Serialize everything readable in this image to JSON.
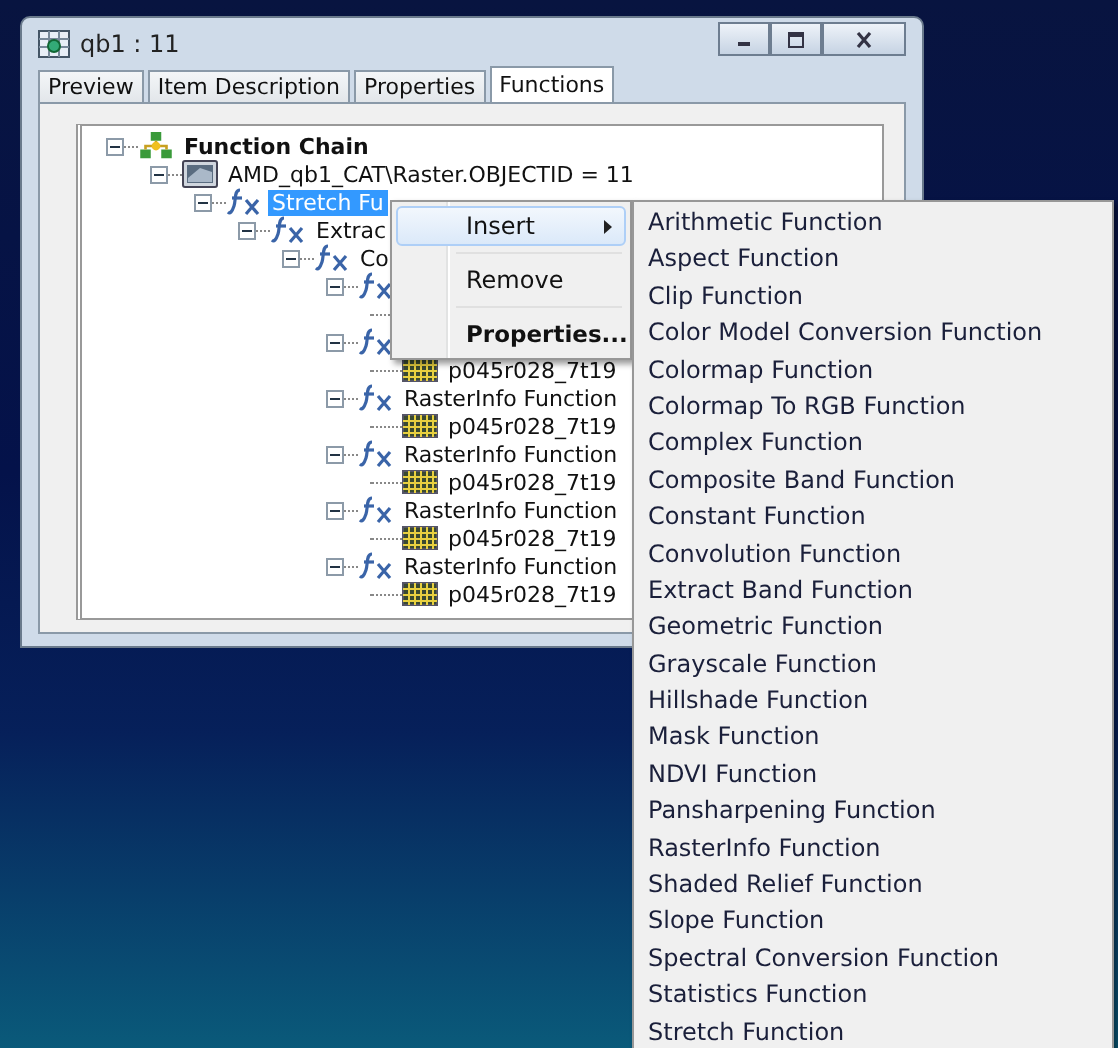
{
  "window": {
    "title": "qb1 : 11"
  },
  "tabs": [
    {
      "label": "Preview",
      "selected": false
    },
    {
      "label": "Item Description",
      "selected": false
    },
    {
      "label": "Properties",
      "selected": false
    },
    {
      "label": "Functions",
      "selected": true
    }
  ],
  "tree": [
    {
      "kind": "chain",
      "label": "Function Chain",
      "expanded": true,
      "selected": false,
      "children": [
        {
          "kind": "dataset",
          "label": "AMD_qb1_CAT\\Raster.OBJECTID = 11",
          "expanded": true,
          "selected": false,
          "children": [
            {
              "kind": "function",
              "label": "Stretch Fu",
              "expanded": true,
              "selected": true,
              "children": [
                {
                  "kind": "function",
                  "label": "Extrac",
                  "expanded": true,
                  "selected": false,
                  "children": [
                    {
                      "kind": "function",
                      "label": "Co",
                      "expanded": true,
                      "selected": false,
                      "children": [
                        {
                          "kind": "function",
                          "expanded": true
                        },
                        {
                          "kind": "function",
                          "expanded": true,
                          "children": [
                            {
                              "kind": "raster",
                              "label": "p045r028_7t19",
                              "selected": false
                            }
                          ]
                        },
                        {
                          "kind": "function",
                          "label": "RasterInfo Function",
                          "expanded": true,
                          "selected": false,
                          "children": [
                            {
                              "kind": "raster",
                              "label": "p045r028_7t19",
                              "selected": false
                            }
                          ]
                        },
                        {
                          "kind": "function",
                          "label": "RasterInfo Function",
                          "expanded": true,
                          "selected": false,
                          "children": [
                            {
                              "kind": "raster",
                              "label": "p045r028_7t19",
                              "selected": false
                            }
                          ]
                        },
                        {
                          "kind": "function",
                          "label": "RasterInfo Function",
                          "expanded": true,
                          "selected": false,
                          "children": [
                            {
                              "kind": "raster",
                              "label": "p045r028_7t19",
                              "selected": false
                            }
                          ]
                        },
                        {
                          "kind": "function",
                          "label": "RasterInfo Function",
                          "expanded": true,
                          "selected": false,
                          "children": [
                            {
                              "kind": "raster",
                              "label": "p045r028_7t19",
                              "selected": false
                            }
                          ]
                        }
                      ]
                    }
                  ]
                }
              ]
            }
          ]
        }
      ]
    }
  ],
  "context_menu": {
    "items": [
      {
        "kind": "submenu",
        "label": "Insert",
        "selected": true
      },
      {
        "kind": "separator"
      },
      {
        "kind": "item",
        "label": "Remove",
        "selected": false
      },
      {
        "kind": "separator"
      },
      {
        "kind": "default",
        "label": "Properties...",
        "selected": false
      }
    ]
  },
  "submenu": {
    "items": [
      "Arithmetic Function",
      "Aspect Function",
      "Clip Function",
      "Color Model Conversion Function",
      "Colormap Function",
      "Colormap To RGB Function",
      "Complex Function",
      "Composite Band Function",
      "Constant Function",
      "Convolution Function",
      "Extract Band Function",
      "Geometric Function",
      "Grayscale Function",
      "Hillshade Function",
      "Mask Function",
      "NDVI Function",
      "Pansharpening Function",
      "RasterInfo Function",
      "Shaded Relief Function",
      "Slope Function",
      "Spectral Conversion Function",
      "Statistics Function",
      "Stretch Function"
    ]
  }
}
